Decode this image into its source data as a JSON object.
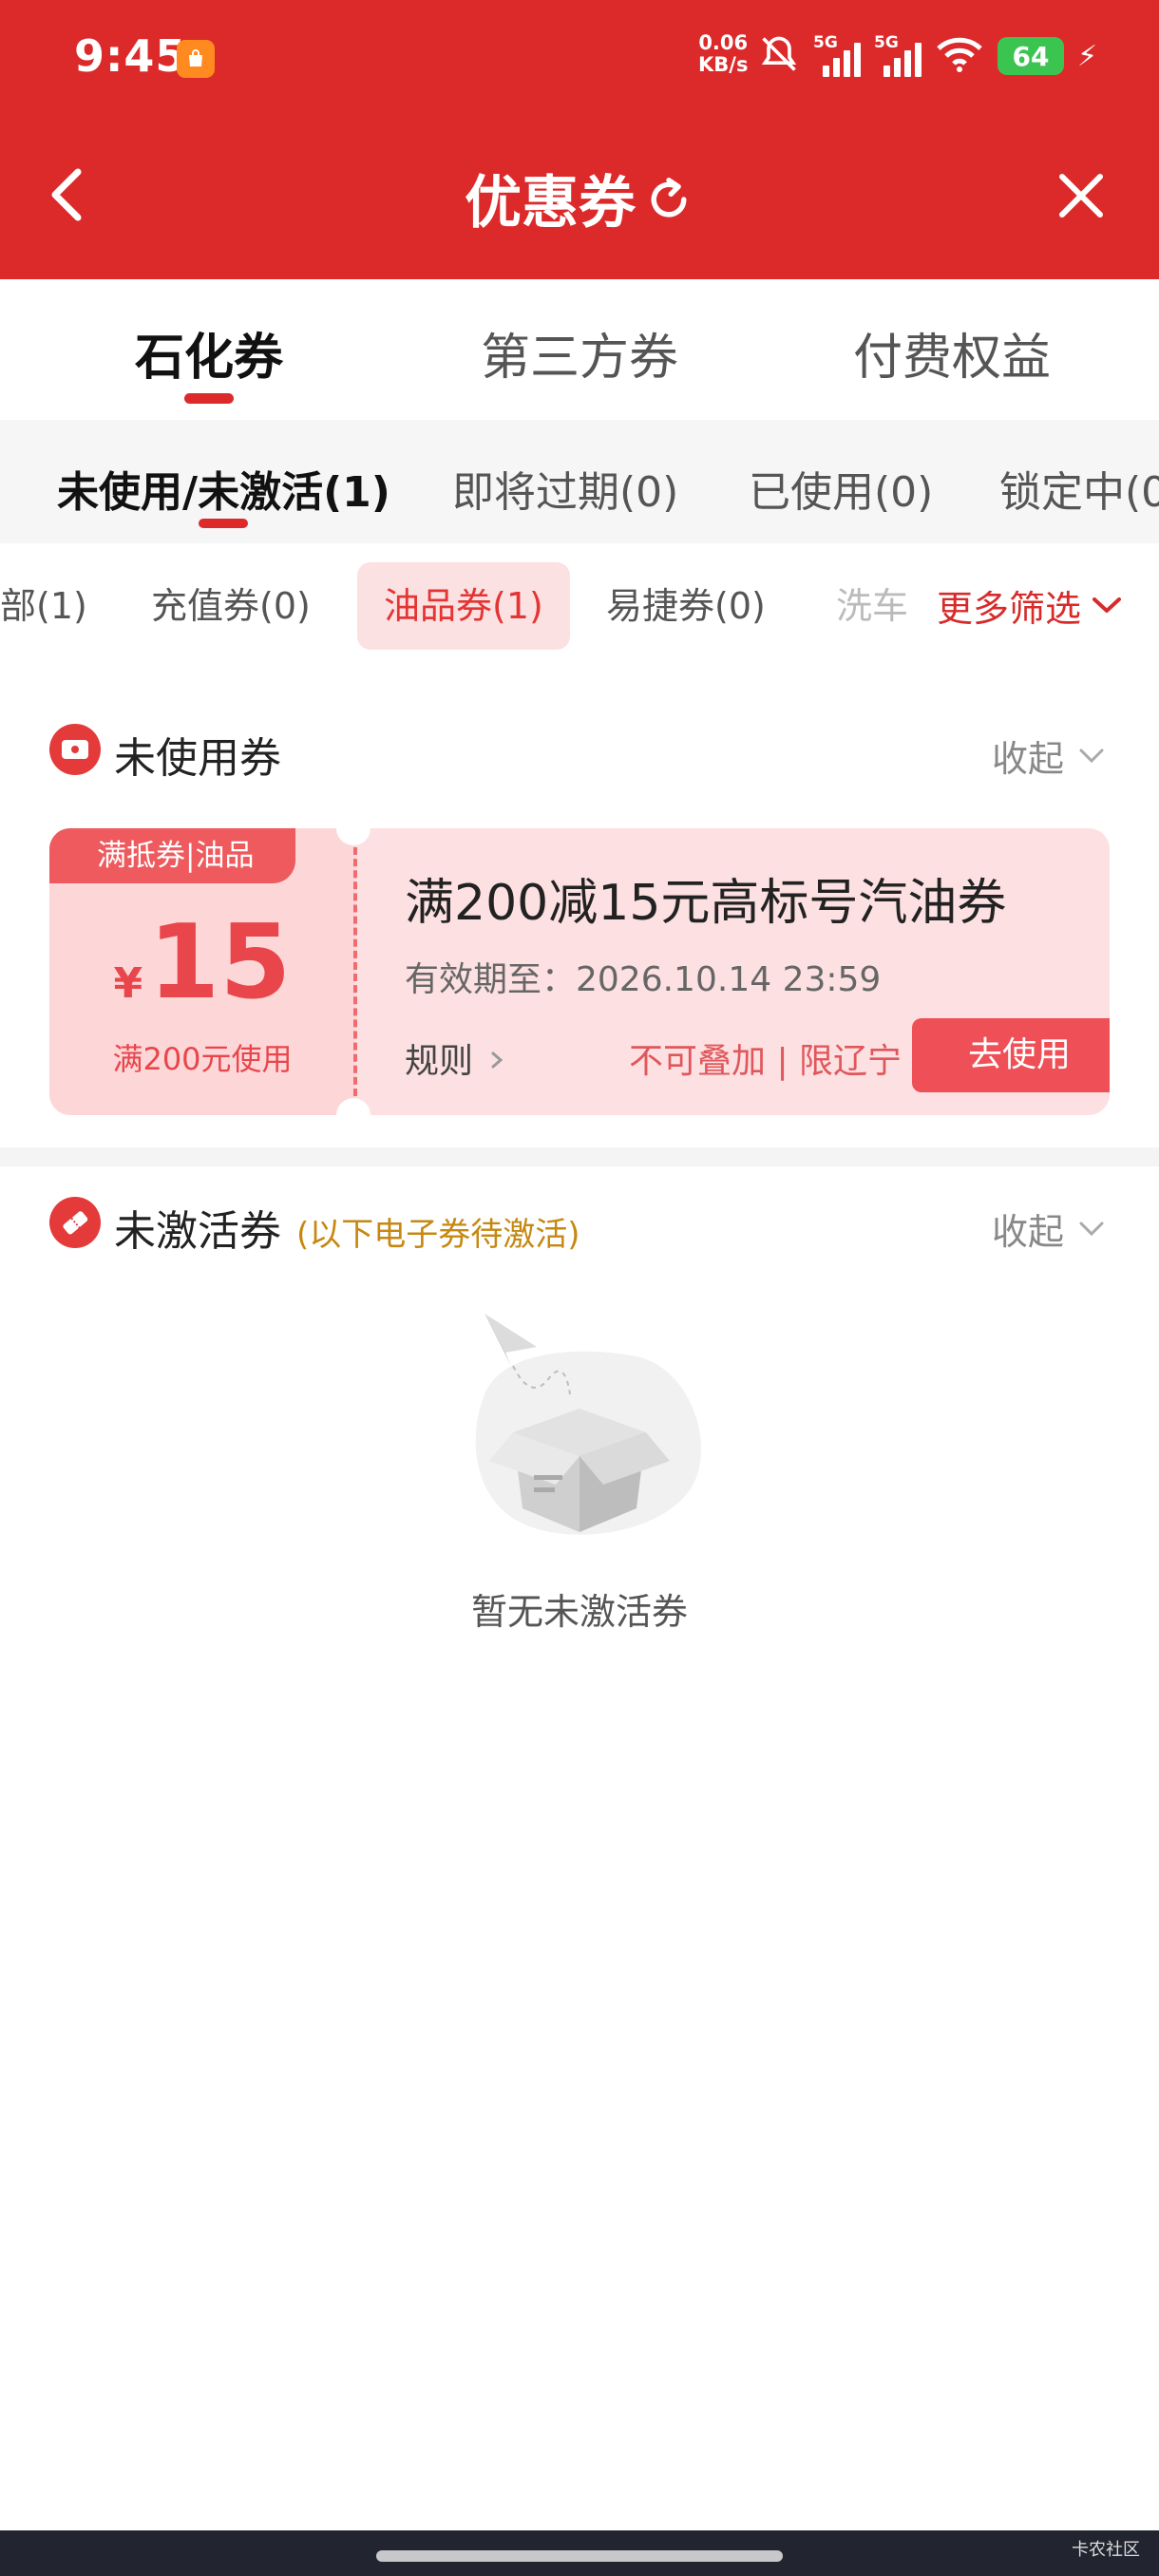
{
  "status_bar": {
    "time": "9:45",
    "app_badge_icon": "shopping-bag-icon",
    "net_speed_value": "0.06",
    "net_speed_unit": "KB/s",
    "signal_label_1": "5G",
    "signal_label_2": "5G",
    "battery": "64"
  },
  "nav": {
    "title": "优惠券"
  },
  "main_tabs": [
    {
      "label": "石化券"
    },
    {
      "label": "第三方券"
    },
    {
      "label": "付费权益"
    }
  ],
  "status_tabs": [
    {
      "label": "未使用/未激活(1)"
    },
    {
      "label": "即将过期(0)"
    },
    {
      "label": "已使用(0)"
    },
    {
      "label": "锁定中(0"
    }
  ],
  "filters": {
    "chips": [
      {
        "label": "部(1)"
      },
      {
        "label": "充值券(0)"
      },
      {
        "label": "油品券(1)"
      },
      {
        "label": "易捷券(0)"
      },
      {
        "label": "洗车"
      }
    ],
    "more": "更多筛选"
  },
  "unused_section": {
    "title": "未使用券",
    "collapse": "收起"
  },
  "coupon": {
    "tag": "满抵券|油品",
    "currency": "¥",
    "amount": "15",
    "condition": "满200元使用",
    "title": "满200减15元高标号汽油券",
    "validity": "有效期至：2026.10.14 23:59",
    "rules": "规则",
    "limits": "不可叠加 | 限辽宁",
    "action": "去使用"
  },
  "inactive_section": {
    "title": "未激活券",
    "subtitle": "(以下电子券待激活)",
    "collapse": "收起"
  },
  "empty_state": {
    "text": "暂无未激活券"
  },
  "watermark": "卡农社区",
  "colors": {
    "brand_red": "#dc2a2a",
    "coupon_bg": "#fde0e2",
    "accent_text": "#e8464b",
    "subtitle_gold": "#c68810"
  }
}
